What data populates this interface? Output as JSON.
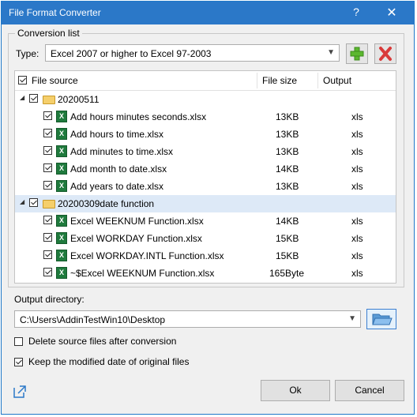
{
  "window": {
    "title": "File Format Converter",
    "help_glyph": "?",
    "close_glyph": "✕"
  },
  "conversion": {
    "group_label": "Conversion list",
    "type_label": "Type:",
    "type_value": "Excel 2007 or higher to Excel 97-2003",
    "add_icon": "plus-icon",
    "remove_icon": "delete-x-icon"
  },
  "list": {
    "columns": {
      "source": "File source",
      "size": "File size",
      "output": "Output"
    },
    "groups": [
      {
        "name": "20200511",
        "files": [
          {
            "name": "Add hours minutes seconds.xlsx",
            "size": "13KB",
            "output": "xls"
          },
          {
            "name": "Add hours to time.xlsx",
            "size": "13KB",
            "output": "xls"
          },
          {
            "name": "Add minutes to time.xlsx",
            "size": "13KB",
            "output": "xls"
          },
          {
            "name": "Add month to date.xlsx",
            "size": "14KB",
            "output": "xls"
          },
          {
            "name": "Add years to date.xlsx",
            "size": "13KB",
            "output": "xls"
          }
        ]
      },
      {
        "name": "20200309date function",
        "files": [
          {
            "name": "Excel WEEKNUM Function.xlsx",
            "size": "14KB",
            "output": "xls"
          },
          {
            "name": "Excel WORKDAY Function.xlsx",
            "size": "15KB",
            "output": "xls"
          },
          {
            "name": "Excel WORKDAY.INTL Function.xlsx",
            "size": "15KB",
            "output": "xls"
          },
          {
            "name": "~$Excel WEEKNUM Function.xlsx",
            "size": "165Byte",
            "output": "xls"
          }
        ]
      }
    ]
  },
  "output": {
    "label": "Output directory:",
    "path": "C:\\Users\\AddinTestWin10\\Desktop"
  },
  "options": {
    "delete_source": {
      "label": "Delete source files after conversion",
      "checked": false
    },
    "keep_date": {
      "label": "Keep the modified date of original files",
      "checked": true
    }
  },
  "buttons": {
    "ok": "Ok",
    "cancel": "Cancel"
  },
  "colors": {
    "titlebar": "#2b78c8",
    "selected_row": "#dde9f7",
    "add_green": "#5bb82f",
    "remove_red": "#d93a3a"
  }
}
